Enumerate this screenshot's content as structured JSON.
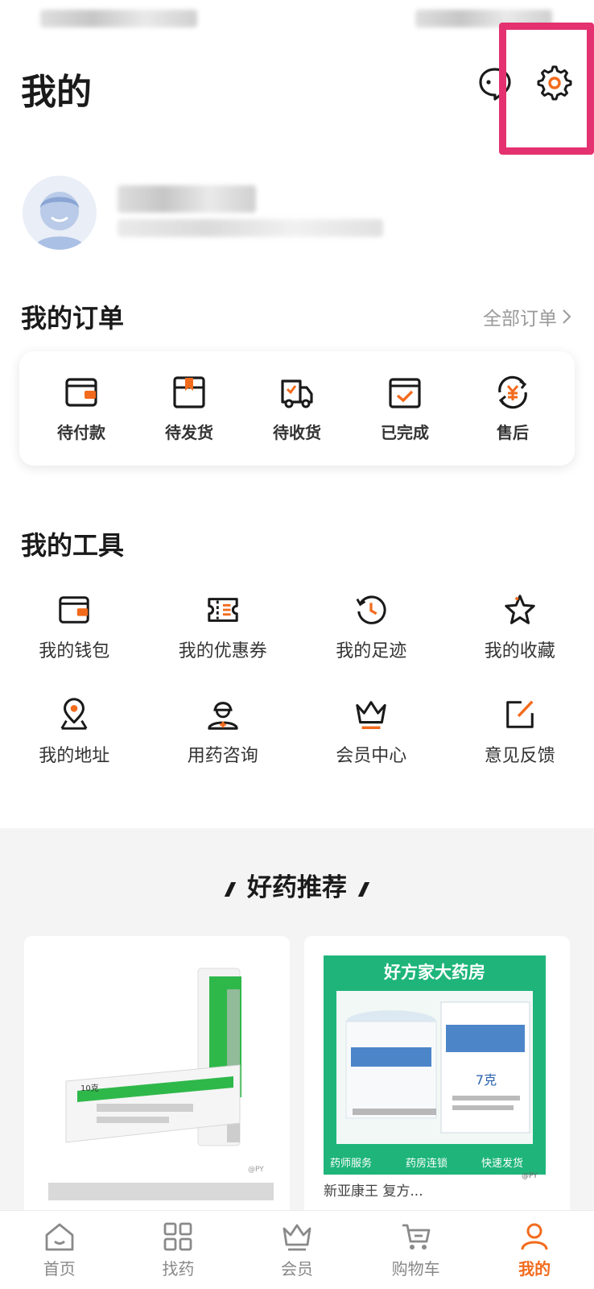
{
  "header": {
    "title": "我的"
  },
  "orders": {
    "title": "我的订单",
    "all_label": "全部订单",
    "items": [
      {
        "label": "待付款",
        "icon": "wallet-icon"
      },
      {
        "label": "待发货",
        "icon": "package-icon"
      },
      {
        "label": "待收货",
        "icon": "truck-icon"
      },
      {
        "label": "已完成",
        "icon": "completed-icon"
      },
      {
        "label": "售后",
        "icon": "after-sales-icon"
      }
    ]
  },
  "tools": {
    "title": "我的工具",
    "items": [
      {
        "label": "我的钱包",
        "icon": "wallet-icon"
      },
      {
        "label": "我的优惠券",
        "icon": "coupon-icon"
      },
      {
        "label": "我的足迹",
        "icon": "history-icon"
      },
      {
        "label": "我的收藏",
        "icon": "star-icon"
      },
      {
        "label": "我的地址",
        "icon": "location-icon"
      },
      {
        "label": "用药咨询",
        "icon": "pharmacist-icon"
      },
      {
        "label": "会员中心",
        "icon": "crown-icon"
      },
      {
        "label": "意见反馈",
        "icon": "feedback-icon"
      }
    ]
  },
  "recommend": {
    "title": "好药推荐",
    "right_card": {
      "banner": "好方家大药房",
      "weight": "7克",
      "badges": [
        "药师服务",
        "药房连锁",
        "快速发货"
      ],
      "watermark": "@PY",
      "caption": "新亚康王 复方..."
    },
    "left_card": {
      "watermark": "@PY",
      "box_text": "10克"
    }
  },
  "tabbar": {
    "items": [
      {
        "label": "首页",
        "icon": "home-icon",
        "active": false
      },
      {
        "label": "找药",
        "icon": "grid-icon",
        "active": false
      },
      {
        "label": "会员",
        "icon": "crown-icon",
        "active": false
      },
      {
        "label": "购物车",
        "icon": "cart-icon",
        "active": false
      },
      {
        "label": "我的",
        "icon": "user-icon",
        "active": true
      }
    ]
  },
  "colors": {
    "accent": "#f26b1d",
    "highlight": "#e4316f",
    "green": "#1fb57a"
  }
}
